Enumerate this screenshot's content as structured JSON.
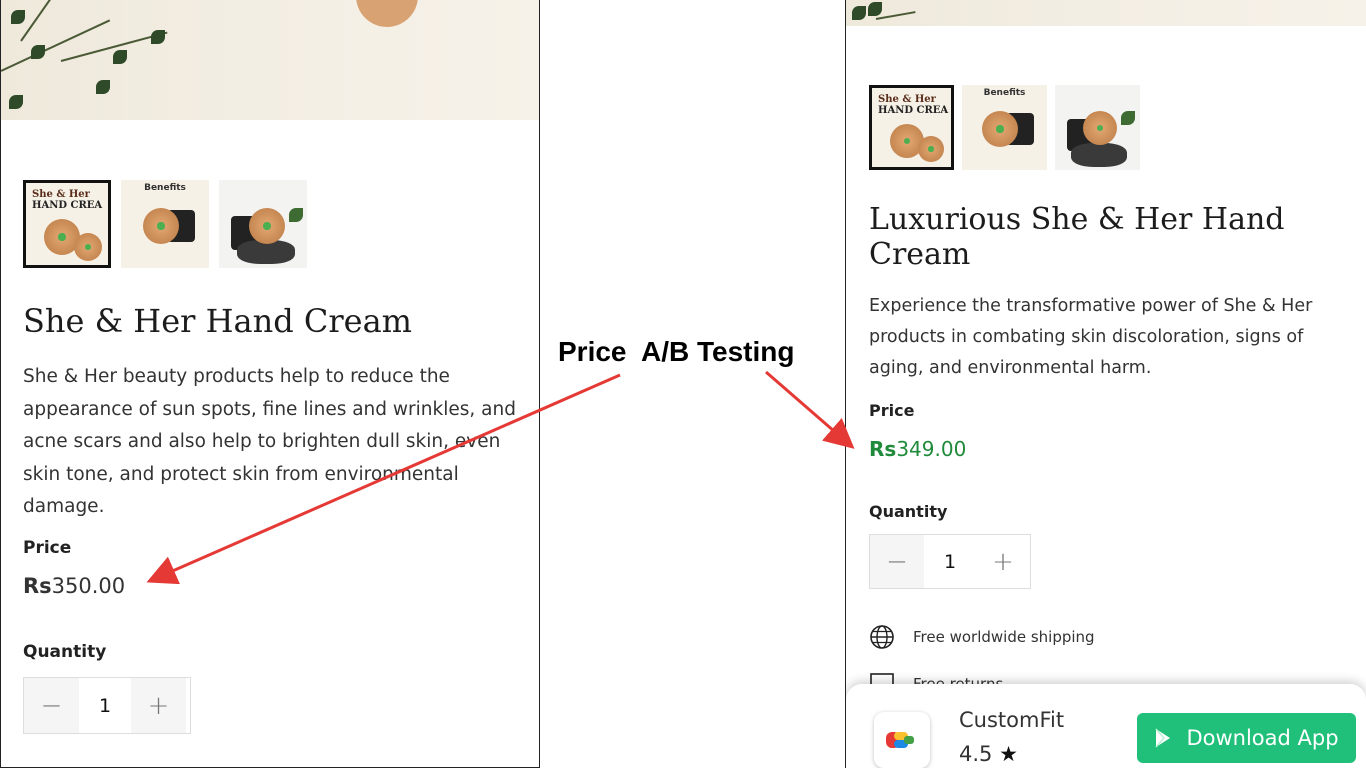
{
  "annotation": {
    "label": "Price  A/B Testing"
  },
  "variant_a": {
    "title": "She & Her Hand Cream",
    "description": "She & Her beauty products help to reduce the appearance of sun spots, fine lines and wrinkles, and acne scars and also help to brighten dull skin, even skin tone, and protect skin from environmental damage.",
    "price_label": "Price",
    "currency": "Rs",
    "price_value": "350.00",
    "quantity_label": "Quantity",
    "quantity": "1",
    "price_color": "#333333",
    "thumbnails": [
      {
        "text_line1": "She & Her",
        "text_line2": "HAND CREA"
      },
      {
        "caption": "Benefits"
      },
      {
        "caption": ""
      }
    ]
  },
  "variant_b": {
    "title": "Luxurious She & Her Hand Cream",
    "description": "Experience the transformative power of She & Her products in combating skin discoloration, signs of aging, and environmental harm.",
    "price_label": "Price",
    "currency": "Rs",
    "price_value": "349.00",
    "quantity_label": "Quantity",
    "quantity": "1",
    "price_color": "#1f8a3a",
    "features": [
      {
        "icon": "globe-icon",
        "label": "Free worldwide shipping"
      },
      {
        "icon": "returns-icon",
        "label": "Free returns"
      }
    ],
    "thumbnails": [
      {
        "text_line1": "She & Her",
        "text_line2": "HAND CREA"
      },
      {
        "caption": "Benefits"
      },
      {
        "caption": ""
      }
    ],
    "app_banner": {
      "app_name": "CustomFit",
      "rating": "4.5",
      "button_label": "Download App",
      "button_color": "#21c07a"
    }
  },
  "colors": {
    "arrow": "#e53935",
    "accent_green": "#1f8a3a"
  }
}
